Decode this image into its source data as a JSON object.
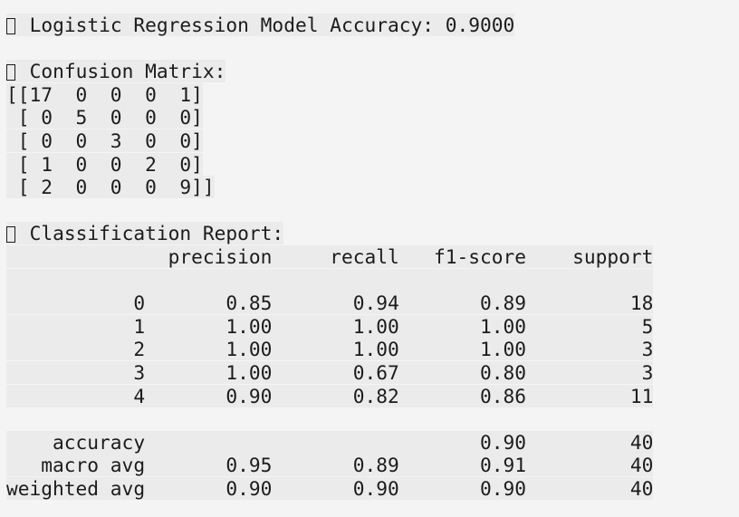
{
  "accuracy_line": {
    "icon": "missing-glyph-icon",
    "text": "Logistic Regression Model Accuracy: 0.9000"
  },
  "confusion_matrix": {
    "icon": "missing-glyph-icon",
    "title": "Confusion Matrix:",
    "rows": [
      "[[17  0  0  0  1]",
      " [ 0  5  0  0  0]",
      " [ 0  0  3  0  0]",
      " [ 1  0  0  2  0]",
      " [ 2  0  0  0  9]]"
    ]
  },
  "classification_report": {
    "icon": "missing-glyph-icon",
    "title": "Classification Report:",
    "header": [
      "precision",
      "recall",
      "f1-score",
      "support"
    ],
    "class_rows": [
      [
        "0",
        "0.85",
        "0.94",
        "0.89",
        "18"
      ],
      [
        "1",
        "1.00",
        "1.00",
        "1.00",
        "5"
      ],
      [
        "2",
        "1.00",
        "1.00",
        "1.00",
        "3"
      ],
      [
        "3",
        "1.00",
        "0.67",
        "0.80",
        "3"
      ],
      [
        "4",
        "0.90",
        "0.82",
        "0.86",
        "11"
      ]
    ],
    "summary_rows": [
      [
        "accuracy",
        "",
        "",
        "0.90",
        "40"
      ],
      [
        "macro avg",
        "0.95",
        "0.89",
        "0.91",
        "40"
      ],
      [
        "weighted avg",
        "0.90",
        "0.90",
        "0.90",
        "40"
      ]
    ]
  }
}
